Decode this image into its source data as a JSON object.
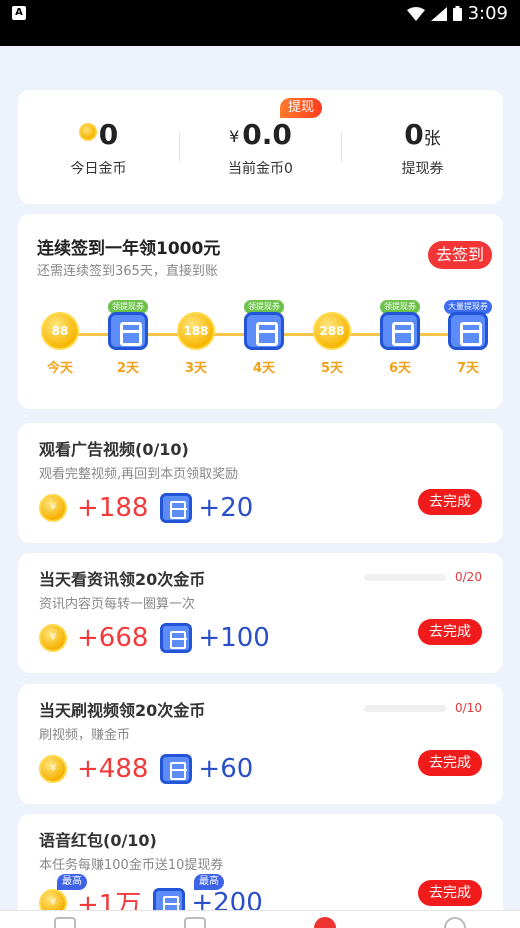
{
  "status_bar": {
    "time": "3:09",
    "app_badge": "A"
  },
  "summary": {
    "withdraw_badge": "提现",
    "today_coins": {
      "value": "0",
      "label": "今日金币"
    },
    "current_coins": {
      "prefix": "¥",
      "value": "0.0",
      "label": "当前金币0"
    },
    "vouchers": {
      "value": "0",
      "unit": "张",
      "label": "提现券"
    }
  },
  "signin": {
    "title": "连续签到一年领1000元",
    "subtitle": "还需连续签到365天，直接到账",
    "button": "去签到",
    "days": [
      {
        "label": "今天",
        "type": "coin",
        "amount": "88",
        "tag": ""
      },
      {
        "label": "2天",
        "type": "ticket",
        "amount": "",
        "tag": "领提现券"
      },
      {
        "label": "3天",
        "type": "coin",
        "amount": "188",
        "tag": ""
      },
      {
        "label": "4天",
        "type": "ticket",
        "amount": "",
        "tag": "领提现券"
      },
      {
        "label": "5天",
        "type": "coin",
        "amount": "288",
        "tag": ""
      },
      {
        "label": "6天",
        "type": "ticket",
        "amount": "",
        "tag": "领提现券"
      },
      {
        "label": "7天",
        "type": "ticket",
        "amount": "",
        "tag": "大量提现券"
      }
    ]
  },
  "tasks": [
    {
      "title": "观看广告视频(0/10)",
      "subtitle": "观看完整视频,再回到本页领取奖励",
      "coin_reward": "+188",
      "ticket_reward": "+20",
      "button": "去完成",
      "progress": "",
      "progress_fraction": null
    },
    {
      "title": "当天看资讯领20次金币",
      "subtitle": "资讯内容页每转一圈算一次",
      "coin_reward": "+668",
      "ticket_reward": "+100",
      "button": "去完成",
      "progress": "0/20",
      "progress_fraction": 0
    },
    {
      "title": "当天刷视频领20次金币",
      "subtitle": "刷视频，赚金币",
      "coin_reward": "+488",
      "ticket_reward": "+60",
      "button": "去完成",
      "progress": "0/10",
      "progress_fraction": 0
    },
    {
      "title": "语音红包(0/10)",
      "subtitle": "本任务每赚100金币送10提现券",
      "coin_reward": "+1万",
      "ticket_reward": "+200",
      "button": "去完成",
      "progress": "",
      "progress_fraction": null,
      "max_tag": "最高"
    }
  ],
  "coin_glyph": "¥",
  "colors": {
    "accent_red": "#f11b1b",
    "coin_gold": "#f5b000",
    "ticket_blue": "#2455d8",
    "background": "#eef2fb"
  }
}
